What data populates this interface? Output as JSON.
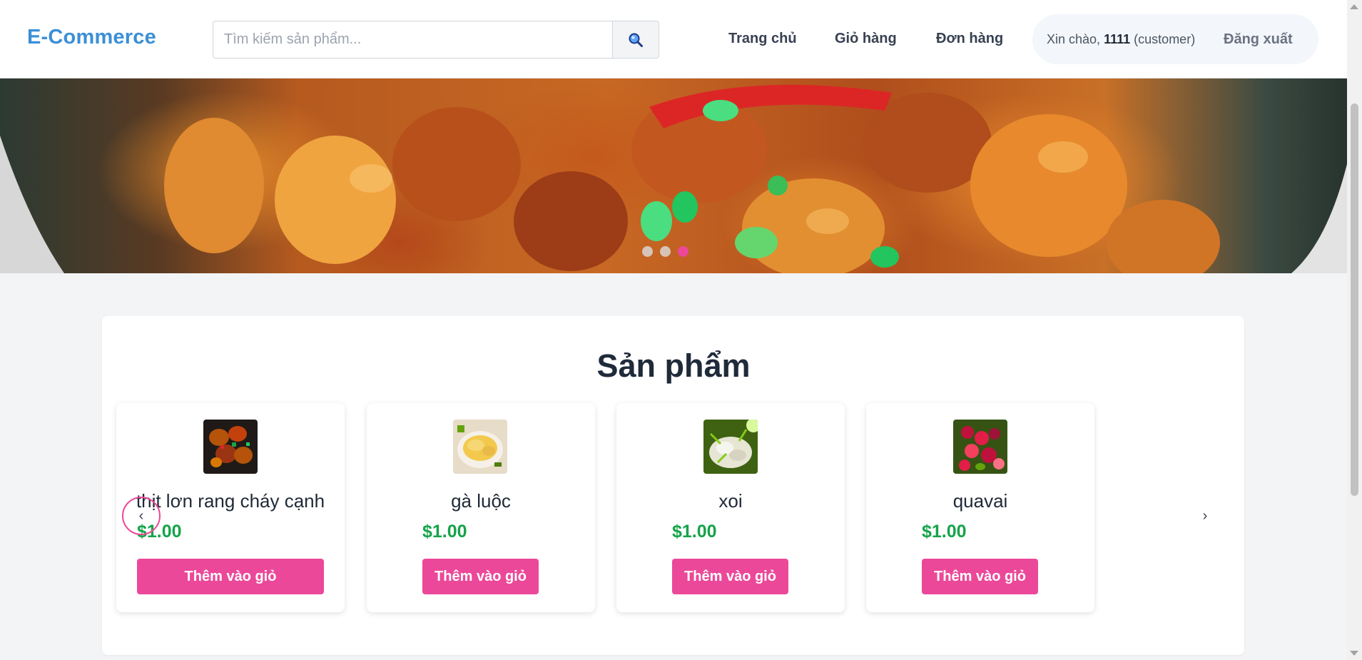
{
  "header": {
    "logo": "E-Commerce",
    "search_placeholder": "Tìm kiếm sản phẩm...",
    "search_icon": "search-icon",
    "nav": [
      {
        "label": "Trang chủ"
      },
      {
        "label": "Giỏ hàng"
      },
      {
        "label": "Đơn hàng"
      }
    ],
    "user": {
      "greeting_prefix": "Xin chào,",
      "username": "1111",
      "role": "(customer)",
      "logout_label": "Đăng xuất"
    }
  },
  "hero": {
    "slide_count": 3,
    "active_slide": 3
  },
  "products": {
    "title": "Sản phẩm",
    "prev_label": "‹",
    "next_label": "›",
    "items": [
      {
        "name": "thịt lơn rang cháy cạnh",
        "price": "$1.00",
        "button": "Thêm vào giỏ"
      },
      {
        "name": "gà luộc",
        "price": "$1.00",
        "button": "Thêm vào giỏ"
      },
      {
        "name": "xoi",
        "price": "$1.00",
        "button": "Thêm vào giỏ"
      },
      {
        "name": "quavai",
        "price": "$1.00",
        "button": "Thêm vào giỏ"
      }
    ]
  },
  "colors": {
    "brand": "#3b8fd6",
    "accent": "#ec4899",
    "price": "#16a34a"
  }
}
